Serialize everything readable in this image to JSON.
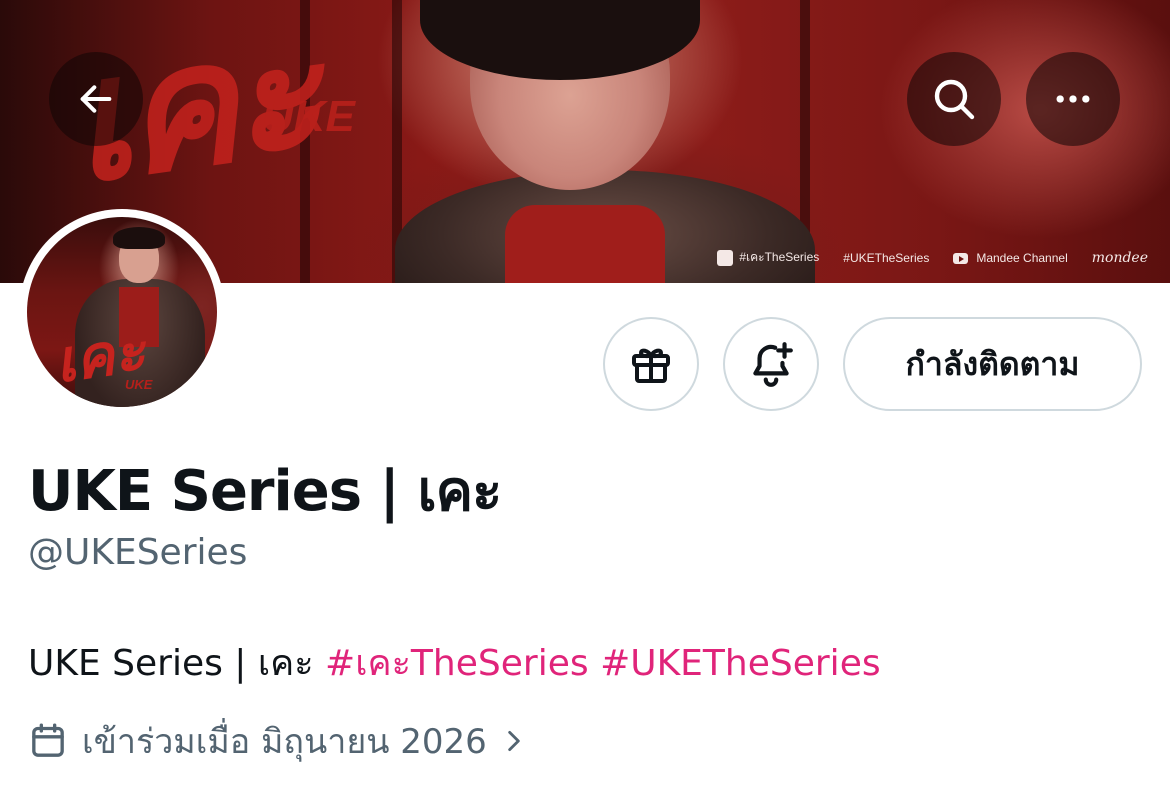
{
  "banner": {
    "art_title": "เคะ",
    "art_subtitle": "UKE",
    "credits": {
      "hashtag_thai": "#เคะTheSeries",
      "hashtag_en": "#UKETheSeries",
      "channel": "Mandee Channel",
      "brand": "mondee"
    }
  },
  "nav": {
    "back_icon": "arrow-left-icon",
    "search_icon": "search-icon",
    "more_icon": "more-horizontal-icon"
  },
  "avatar": {
    "art_title": "เคะ",
    "art_subtitle": "UKE"
  },
  "actions": {
    "gift_icon": "gift-icon",
    "notify_icon": "bell-plus-icon",
    "follow_label": "กำลังติดตาม"
  },
  "profile": {
    "display_name": "UKE Series | เคะ",
    "handle": "@UKESeries",
    "bio_text": "UKE Series | เคะ ",
    "bio_tags": [
      "#เคะTheSeries",
      "#UKETheSeries"
    ],
    "joined_label": "เข้าร่วมเมื่อ มิถุนายน 2026",
    "joined_icon": "calendar-icon"
  },
  "colors": {
    "hashtag": "#e0247a",
    "secondary_text": "#536471",
    "primary_text": "#0f1419",
    "border": "#cfd9de"
  }
}
